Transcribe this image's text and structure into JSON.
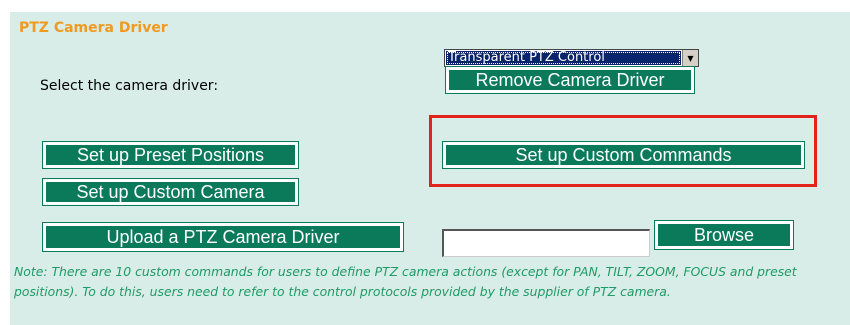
{
  "section": {
    "title": "PTZ Camera Driver"
  },
  "driver": {
    "label": "Select the camera driver:",
    "selected": "Transparent PTZ Control",
    "arrow_icon": "chevron-down-icon"
  },
  "buttons": {
    "remove_driver": "Remove Camera Driver",
    "preset_positions": "Set up Preset Positions",
    "custom_commands": "Set up Custom Commands",
    "custom_camera": "Set up Custom Camera",
    "upload_driver": "Upload a PTZ Camera Driver",
    "browse": "Browse"
  },
  "upload": {
    "value": ""
  },
  "note": "Note: There are 10 custom commands for users to define PTZ camera actions (except for PAN, TILT, ZOOM, FOCUS and preset positions). To do this, users need to refer to the control protocols provided by the supplier of PTZ camera.",
  "colors": {
    "panel_bg": "#d8ede8",
    "title": "#f09a1f",
    "button_bg": "#0a7a5b",
    "highlight": "#e2231a",
    "note_text": "#1f9a66"
  }
}
